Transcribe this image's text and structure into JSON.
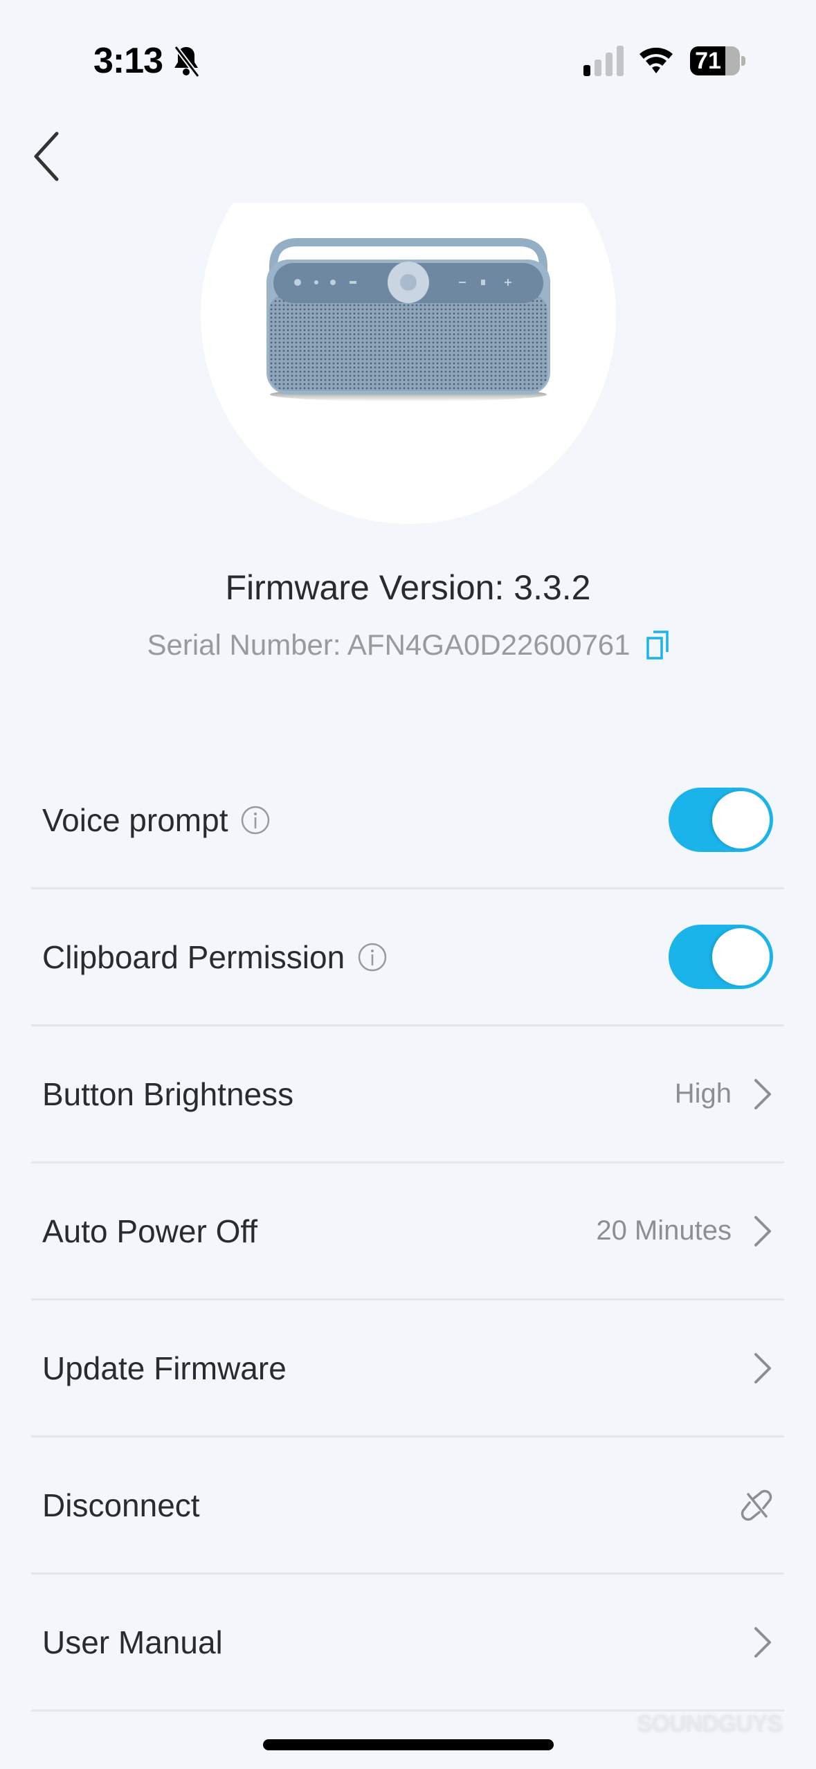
{
  "status_bar": {
    "time": "3:13",
    "silent_icon": "bell-slash-icon",
    "signal_icon": "cellular-signal-icon",
    "signal_bars_active": 1,
    "signal_bars_total": 4,
    "wifi_icon": "wifi-icon",
    "battery_percent": "71",
    "battery_level": 0.71
  },
  "nav": {
    "back_icon": "chevron-left-icon"
  },
  "device": {
    "image": "speaker-product-image",
    "firmware_label": "Firmware Version: 3.3.2",
    "serial_label": "Serial Number: AFN4GA0D22600761",
    "copy_icon": "copy-icon"
  },
  "settings": {
    "accent_color": "#1ab4ea",
    "items": [
      {
        "label": "Voice prompt",
        "type": "toggle",
        "on": true,
        "info_icon": "info-icon"
      },
      {
        "label": "Clipboard Permission",
        "type": "toggle",
        "on": true,
        "info_icon": "info-icon"
      },
      {
        "label": "Button Brightness",
        "type": "link",
        "value": "High"
      },
      {
        "label": "Auto Power Off",
        "type": "link",
        "value": "20 Minutes"
      },
      {
        "label": "Update Firmware",
        "type": "link"
      },
      {
        "label": "Disconnect",
        "type": "action",
        "icon": "unlink-icon"
      },
      {
        "label": "User Manual",
        "type": "link"
      }
    ]
  },
  "watermark": "SOUNDGUYS"
}
